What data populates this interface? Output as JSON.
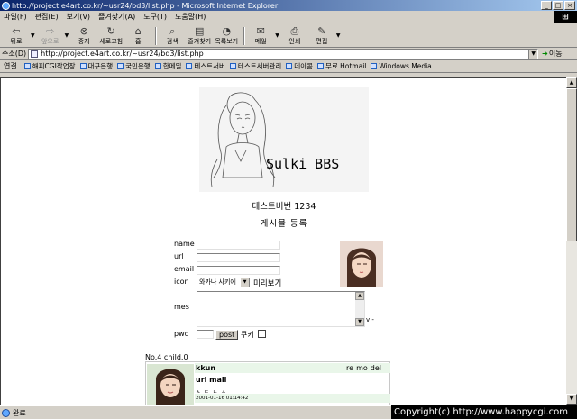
{
  "window": {
    "title": "http://project.e4art.co.kr/~usr24/bd3/list.php - Microsoft Internet Explorer",
    "controls": [
      "_",
      "□",
      "×"
    ]
  },
  "menu": [
    "파일(F)",
    "편집(E)",
    "보기(V)",
    "즐겨찾기(A)",
    "도구(T)",
    "도움말(H)"
  ],
  "toolbar": {
    "back": "뒤로",
    "forward": "앞으로",
    "stop": "중지",
    "refresh": "새로고침",
    "home": "홈",
    "search": "검색",
    "favorites": "즐겨찾기",
    "history": "목록보기",
    "mail": "메일",
    "print": "인쇄",
    "edit": "편집"
  },
  "address": {
    "label": "주소(D)",
    "url": "http://project.e4art.co.kr/~usr24/bd3/list.php",
    "go": "이동"
  },
  "links": {
    "label": "연결",
    "items": [
      "해피CGI작업장",
      "대구은행",
      "국민은행",
      "한메일",
      "테스트서버",
      "테스트서버관리",
      "데이콤",
      "무료 Hotmail",
      "Windows Media"
    ]
  },
  "page": {
    "logo_title": "Sulki BBS",
    "board_name": "테스트비번 1234",
    "post_heading": "게시물 등록",
    "form": {
      "name_label": "name",
      "url_label": "url",
      "email_label": "email",
      "icon_label": "icon",
      "icon_selected": "와카나 사키에",
      "preview_label": "미리보기",
      "mes_label": "mes",
      "mes_extra": "v -",
      "pwd_label": "pwd",
      "post_button": "post",
      "cookie_label": "쿠키"
    },
    "entry": {
      "meta": "No.4 child.0",
      "author": "kkun",
      "actions": [
        "re",
        "mo",
        "del"
      ],
      "info": "url mail",
      "message": "ㅅ ㄷ ㄴ ㅅ",
      "date": "2001-01-16 01:14:42"
    }
  },
  "status": {
    "text": "완료",
    "copyright": "Copyright(c) http://www.happycgi.com"
  }
}
